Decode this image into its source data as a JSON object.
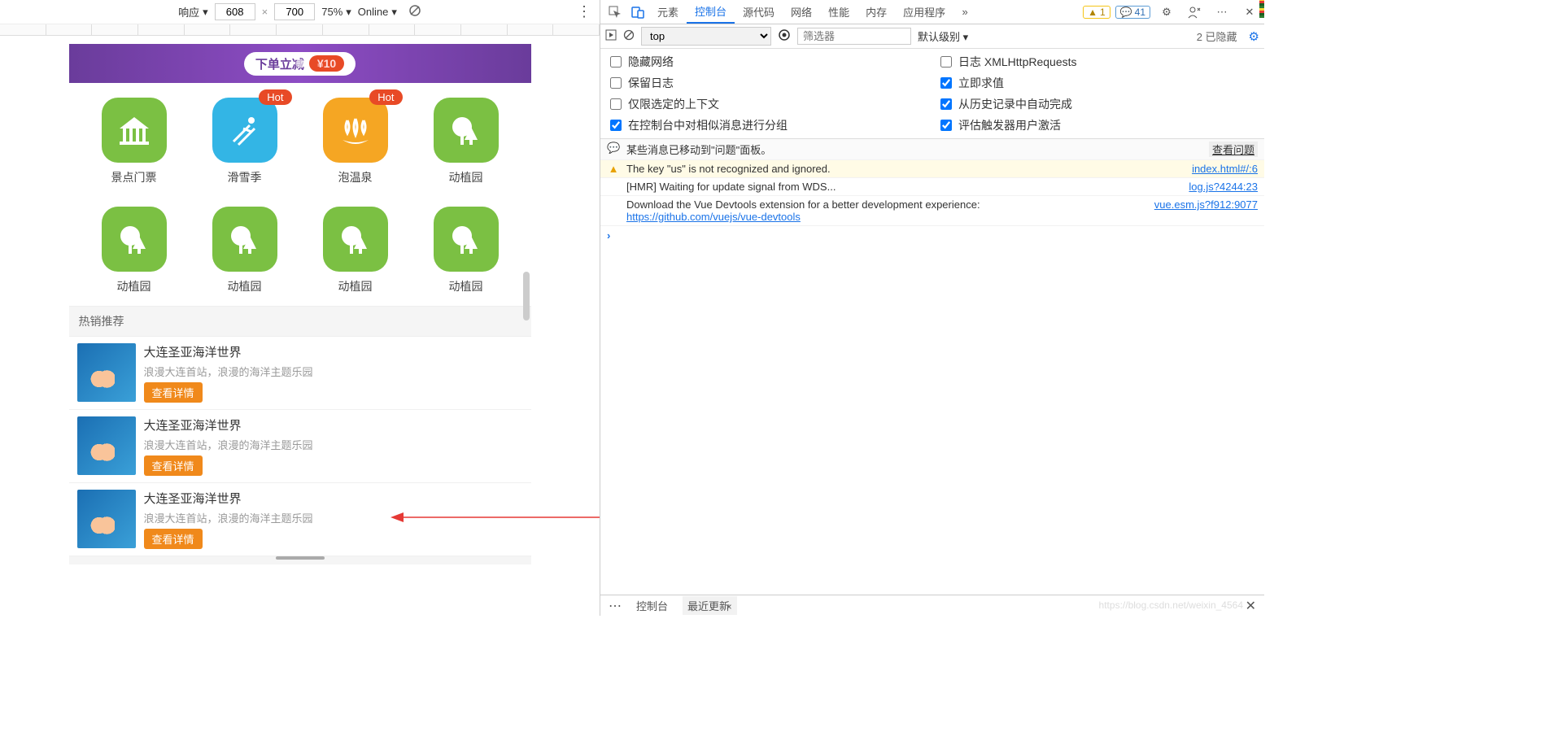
{
  "device_toolbar": {
    "device": "响应",
    "width": "608",
    "height": "700",
    "zoom": "75%",
    "throttle": "Online"
  },
  "banner": {
    "text": "下单立减",
    "price": "¥10"
  },
  "icon_grid": [
    {
      "label": "景点门票",
      "color": "green",
      "icon": "pavilion",
      "hot": false
    },
    {
      "label": "滑雪季",
      "color": "blue",
      "icon": "ski",
      "hot": true
    },
    {
      "label": "泡温泉",
      "color": "orange",
      "icon": "spa",
      "hot": true
    },
    {
      "label": "动植园",
      "color": "green",
      "icon": "tree",
      "hot": false
    },
    {
      "label": "动植园",
      "color": "green",
      "icon": "tree",
      "hot": false
    },
    {
      "label": "动植园",
      "color": "green",
      "icon": "tree",
      "hot": false
    },
    {
      "label": "动植园",
      "color": "green",
      "icon": "tree",
      "hot": false
    },
    {
      "label": "动植园",
      "color": "green",
      "icon": "tree",
      "hot": false
    }
  ],
  "hot_badge": "Hot",
  "section_header": "热销推荐",
  "list": [
    {
      "title": "大连圣亚海洋世界",
      "sub": "浪漫大连首站，浪漫的海洋主题乐园",
      "btn": "查看详情"
    },
    {
      "title": "大连圣亚海洋世界",
      "sub": "浪漫大连首站，浪漫的海洋主题乐园",
      "btn": "查看详情"
    },
    {
      "title": "大连圣亚海洋世界",
      "sub": "浪漫大连首站，浪漫的海洋主题乐园",
      "btn": "查看详情"
    }
  ],
  "tabs": {
    "elements": "元素",
    "console": "控制台",
    "sources": "源代码",
    "network": "网络",
    "performance": "性能",
    "memory": "内存",
    "application": "应用程序"
  },
  "badges": {
    "warn": "1",
    "info": "41"
  },
  "console_toolbar": {
    "context": "top",
    "filter_placeholder": "筛选器",
    "level": "默认级别",
    "hidden": "2 已隐藏"
  },
  "settings": {
    "hide_network": "隐藏网络",
    "preserve_log": "保留日志",
    "selected_context": "仅限选定的上下文",
    "group_similar": "在控制台中对相似消息进行分组",
    "log_xhr": "日志 XMLHttpRequests",
    "eager_eval": "立即求值",
    "history_autocomplete": "从历史记录中自动完成",
    "user_activation": "评估触发器用户激活"
  },
  "messages": {
    "issues": {
      "text": "某些消息已移动到\"问题\"面板。",
      "link": "查看问题"
    },
    "warn": {
      "text": "The key \"us\" is not recognized and ignored.",
      "link": "index.html#/:6"
    },
    "hmr": {
      "text": "[HMR] Waiting for update signal from WDS...",
      "link": "log.js?4244:23"
    },
    "vue": {
      "text1": "Download the Vue Devtools extension for a better development experience: ",
      "url": "https://github.com/vuejs/vue-devtools",
      "link": "vue.esm.js?f912:9077"
    }
  },
  "drawer": {
    "console": "控制台",
    "whatsnew": "最近更新"
  },
  "watermark": "https://blog.csdn.net/weixin_4564"
}
